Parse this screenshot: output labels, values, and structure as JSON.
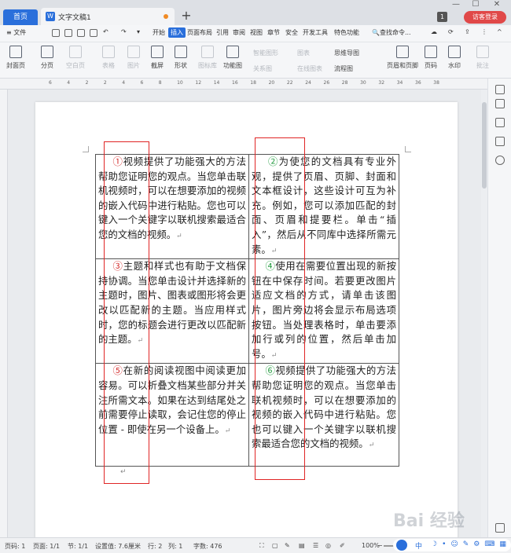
{
  "titlebar": {
    "home_tab": "首页",
    "doc_tab": "文字文稿1",
    "doc_icon": "W",
    "add_tab": "+",
    "window_badge": "1",
    "login_button": "访客登录",
    "minimize": "—",
    "maximize": "☐",
    "close": "✕"
  },
  "menu": {
    "file": "≡ 文件",
    "items": [
      "开始",
      "插入",
      "页面布局",
      "引用",
      "审阅",
      "视图",
      "章节",
      "安全",
      "开发工具",
      "特色功能"
    ],
    "active": "插入",
    "search": "🔍查找命令..."
  },
  "ribbon": {
    "cover": "封面页",
    "page_break": "分页",
    "blank_page": "空白页",
    "table": "表格",
    "picture": "图片",
    "screenshot": "截屏",
    "shape": "形状",
    "icon_lib": "图标库",
    "function_chart": "功能图",
    "smart_shape": "智能图形",
    "chart": "图表",
    "mind_map": "思维导图",
    "relation": "关系图",
    "online_chart": "在线图表",
    "flowchart": "流程图",
    "header_footer": "页眉和页脚",
    "page_number": "页码",
    "watermark": "水印",
    "comment": "批注"
  },
  "ruler_numbers": [
    "6",
    "4",
    "2",
    "2",
    "4",
    "6",
    "8",
    "10",
    "12",
    "14",
    "16",
    "18",
    "20",
    "22",
    "24",
    "26",
    "28",
    "30",
    "32",
    "34",
    "36",
    "38"
  ],
  "document": {
    "cells": [
      {
        "marker": "①",
        "text": "视频提供了功能强大的方法帮助您证明您的观点。当您单击联机视频时，可以在想要添加的视频的嵌入代码中进行粘贴。您也可以键入一个关键字以联机搜索最适合您的文档的视频。"
      },
      {
        "marker": "②",
        "text": "为使您的文档具有专业外观，提供了页眉、页脚、封面和文本框设计，这些设计可互为补充。例如，您可以添加匹配的封面、页眉和提要栏。单击“插入”，然后从不同库中选择所需元素。"
      },
      {
        "marker": "③",
        "text": "主题和样式也有助于文档保持协调。当您单击设计并选择新的主题时，图片、图表或图形将会更改以匹配新的主题。当应用样式时，您的标题会进行更改以匹配新的主题。"
      },
      {
        "marker": "④",
        "text": "使用在需要位置出现的新按钮在中保存时间。若要更改图片适应文档的方式，请单击该图片，图片旁边将会显示布局选项按钮。当处理表格时，单击要添加行或列的位置，然后单击加号。"
      },
      {
        "marker": "⑤",
        "text": "在新的阅读视图中阅读更加容易。可以折叠文档某些部分并关注所需文本。如果在达到结尾处之前需要停止读取，会记住您的停止位置 - 即使在另一个设备上。"
      },
      {
        "marker": "⑥",
        "text": "视频提供了功能强大的方法帮助您证明您的观点。当您单击联机视频时，可以在想要添加的视频的嵌入代码中进行粘贴。您也可以键入一个关键字以联机搜索最适合您的文档的视频。"
      }
    ],
    "return_mark": "↵",
    "highlight_color": "#e02525"
  },
  "status": {
    "page_num": "页码: 1",
    "pages": "页面: 1/1",
    "section": "节: 1/1",
    "setting": "设置值: 7.6厘米",
    "row": "行: 2",
    "col": "列: 1",
    "word_count": "字数: 476",
    "zoom": "100%",
    "zoom_minus": "−"
  },
  "ime": {
    "label": "中"
  },
  "watermark_text": "Bai 经验"
}
